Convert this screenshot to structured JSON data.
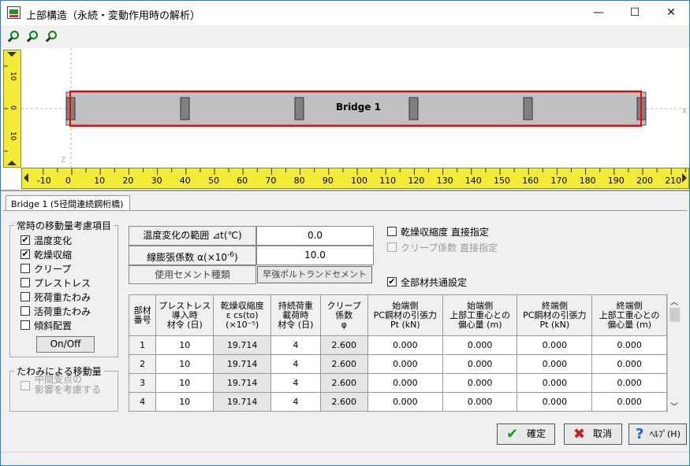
{
  "window": {
    "title": "上部構造（永続・変動作用時の解析）",
    "minimize_glyph": "—",
    "maximize_glyph": "☐",
    "close_glyph": "✕"
  },
  "toolbar": {
    "icons": [
      "zoom-in-icon",
      "zoom-out-icon",
      "zoom-fit-icon"
    ]
  },
  "canvas": {
    "bridge_label": "Bridge 1",
    "axis_x_label": "X",
    "axis_z_label": "Z",
    "h_ruler_ticks": [
      "-10",
      "0",
      "10",
      "20",
      "30",
      "40",
      "50",
      "60",
      "70",
      "80",
      "90",
      "100",
      "110",
      "120",
      "130",
      "140",
      "150",
      "160",
      "170",
      "180",
      "190",
      "200",
      "210"
    ],
    "v_ruler_ticks": [
      "10",
      "0",
      "10"
    ]
  },
  "tab": {
    "label": "Bridge 1 (5径間連続鋼桁橋)"
  },
  "movement_group": {
    "title": "常時の移動量考慮項目",
    "items": [
      {
        "label": "温度変化",
        "checked": true
      },
      {
        "label": "乾燥収縮",
        "checked": true
      },
      {
        "label": "クリープ",
        "checked": false
      },
      {
        "label": "プレストレス",
        "checked": false
      },
      {
        "label": "死荷重たわみ",
        "checked": false
      },
      {
        "label": "活荷重たわみ",
        "checked": false
      },
      {
        "label": "傾斜配置",
        "checked": false
      }
    ],
    "onoff_button": "On/Off"
  },
  "deflection_group": {
    "title": "たわみによる移動量",
    "item_line1": "中間支点の",
    "item_line2": "影響を考慮する"
  },
  "properties": {
    "temp_label": "温度変化の範囲 ⊿t(℃)",
    "temp_value": "0.0",
    "coef_label": "線膨張係数 α(×10",
    "coef_sup": "-6",
    "coef_label_end": ")",
    "coef_value": "10.0",
    "cement_label": "使用セメント種類",
    "cement_value": "早強ポルトランドセメント"
  },
  "options": {
    "dry_direct": "乾燥収縮度 直接指定",
    "creep_direct": "クリープ係数 直接指定",
    "all_common": "全部材共通設定",
    "all_common_checked": "✔"
  },
  "grid": {
    "headers": [
      [
        "部材",
        "番号"
      ],
      [
        "プレストレス",
        "導入時",
        "材令 (日)"
      ],
      [
        "乾燥収縮度",
        "ε cs(to)",
        "(×10⁻⁵)"
      ],
      [
        "持続荷重",
        "載荷時",
        "材令 (日)"
      ],
      [
        "クリープ",
        "係数",
        "φ"
      ],
      [
        "始端側",
        "PC鋼材の引張力",
        "Pt (kN)"
      ],
      [
        "始端側",
        "上部工重心との",
        "偏心量 (m)"
      ],
      [
        "終端側",
        "PC鋼材の引張力",
        "Pt (kN)"
      ],
      [
        "終端側",
        "上部工重心との",
        "偏心量 (m)"
      ]
    ],
    "rows": [
      [
        "1",
        "10",
        "19.714",
        "4",
        "2.600",
        "0.000",
        "0.000",
        "0.000",
        "0.000"
      ],
      [
        "2",
        "10",
        "19.714",
        "4",
        "2.600",
        "0.000",
        "0.000",
        "0.000",
        "0.000"
      ],
      [
        "3",
        "10",
        "19.714",
        "4",
        "2.600",
        "0.000",
        "0.000",
        "0.000",
        "0.000"
      ],
      [
        "4",
        "10",
        "19.714",
        "4",
        "2.600",
        "0.000",
        "0.000",
        "0.000",
        "0.000"
      ]
    ]
  },
  "buttons": {
    "ok": "確定",
    "cancel": "取消",
    "help": "ﾍﾙﾌﾟ(H)"
  },
  "colors": {
    "ruler": "#f3ea3a",
    "girder": "#c0c0c0",
    "selection": "#ff0000",
    "ok_icon": "#1a9a1a",
    "cancel_icon": "#c81e1e",
    "help_icon": "#1e5fc8"
  }
}
